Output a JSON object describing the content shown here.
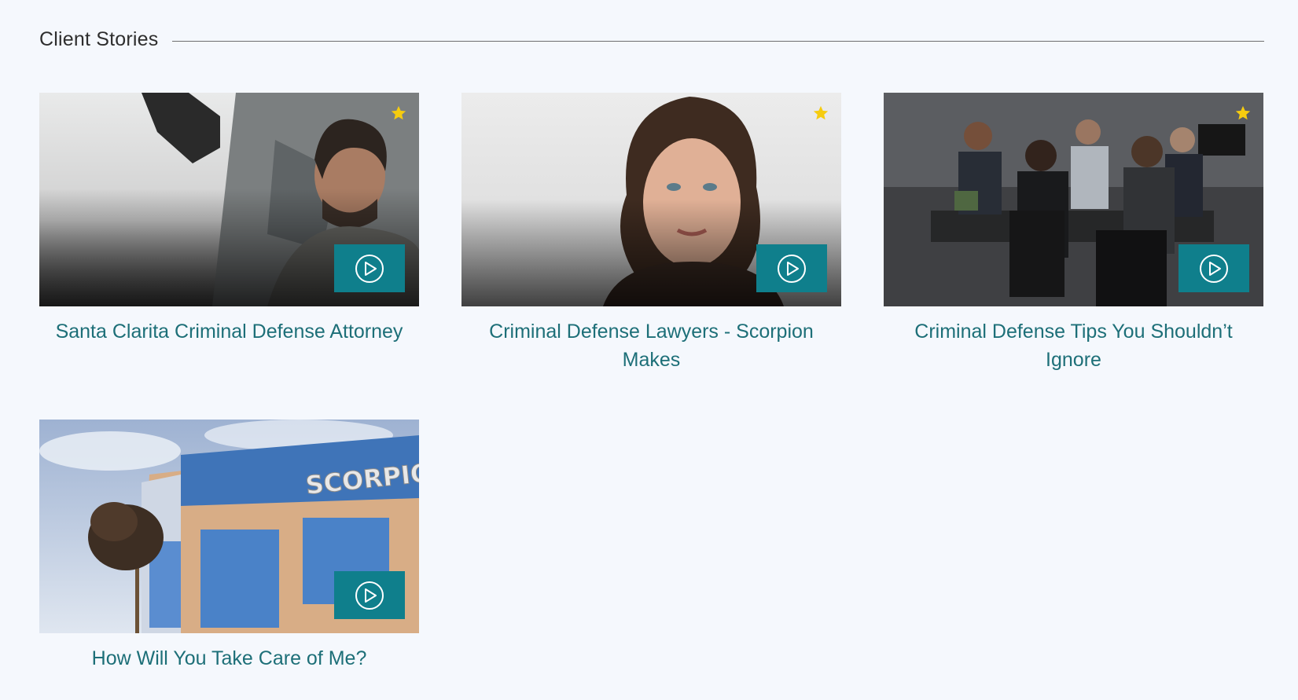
{
  "section": {
    "title": "Client Stories"
  },
  "colors": {
    "accent": "#0f7f8c",
    "caption": "#1d6f78",
    "star": "#f6cc0f",
    "background": "#f5f8fd"
  },
  "videos": [
    {
      "title": "Santa Clarita Criminal Defense Attorney",
      "featured": true,
      "icon": "play-icon"
    },
    {
      "title": "Criminal Defense Lawyers - Scorpion Makes",
      "featured": true,
      "icon": "play-icon"
    },
    {
      "title": "Criminal Defense Tips You Shouldn’t Ignore",
      "featured": true,
      "icon": "play-icon"
    },
    {
      "title": "How Will You Take Care of Me?",
      "featured": false,
      "icon": "play-icon",
      "building_sign": "SCORPION"
    }
  ]
}
